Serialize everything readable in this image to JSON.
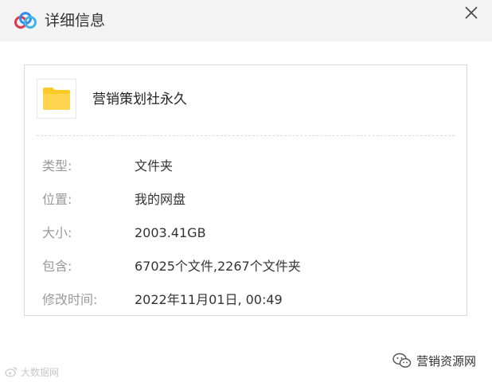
{
  "dialog": {
    "title": "详细信息",
    "app_logo_icon": "baidu-netdisk-logo-icon",
    "close_icon": "close-icon"
  },
  "file": {
    "name": "营销策划社永久",
    "icon": "folder-icon",
    "folder_color": "#ffd54f"
  },
  "details": [
    {
      "label": "类型:",
      "value": "文件夹"
    },
    {
      "label": "位置:",
      "value": "我的网盘"
    },
    {
      "label": "大小:",
      "value": "2003.41GB"
    },
    {
      "label": "包含:",
      "value": "67025个文件,2267个文件夹"
    },
    {
      "label": "修改时间:",
      "value": "2022年11月01日, 00:49"
    }
  ],
  "watermarks": {
    "left_text": "大数据网",
    "right_text": "营销资源网"
  }
}
